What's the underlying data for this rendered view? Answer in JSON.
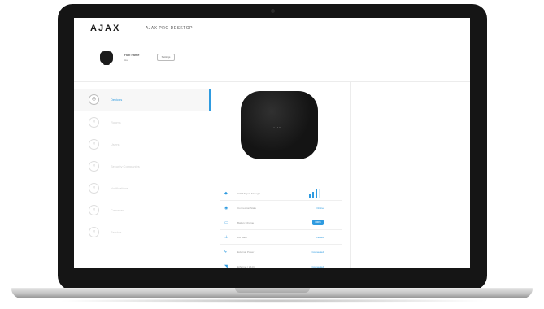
{
  "header": {
    "logo": "AJAX",
    "app_name": "AJAX PRO DESKTOP"
  },
  "hub": {
    "name": "Hub name",
    "room": "Hall",
    "button_label": "Settings"
  },
  "sidebar": {
    "items": [
      {
        "label": "Devices",
        "icon": "devices-icon",
        "active": true
      },
      {
        "label": "Rooms",
        "icon": "rooms-icon"
      },
      {
        "label": "Users",
        "icon": "users-icon"
      },
      {
        "label": "Security Companies",
        "icon": "shield-icon"
      },
      {
        "label": "Notifications",
        "icon": "bell-icon"
      },
      {
        "label": "Cameras",
        "icon": "camera-icon"
      },
      {
        "label": "Service",
        "icon": "wrench-icon"
      }
    ]
  },
  "device": {
    "brand": "AJAX"
  },
  "stats": [
    {
      "icon": "signal-icon",
      "label": "GSM Signal Strength",
      "type": "bars",
      "level": 0.75
    },
    {
      "icon": "connection-icon",
      "label": "Connection State",
      "value": "Online"
    },
    {
      "icon": "battery-icon",
      "label": "Battery Charge",
      "type": "pill",
      "value": "100%"
    },
    {
      "icon": "lid-icon",
      "label": "Lid State",
      "value": "Closed"
    },
    {
      "icon": "power-icon",
      "label": "External Power",
      "value": "Connected"
    },
    {
      "icon": "wifi-icon",
      "label": "Ethernet / Wi-Fi",
      "value": "Connected"
    }
  ],
  "colors": {
    "accent": "#2f9be0",
    "frame": "#151515"
  }
}
